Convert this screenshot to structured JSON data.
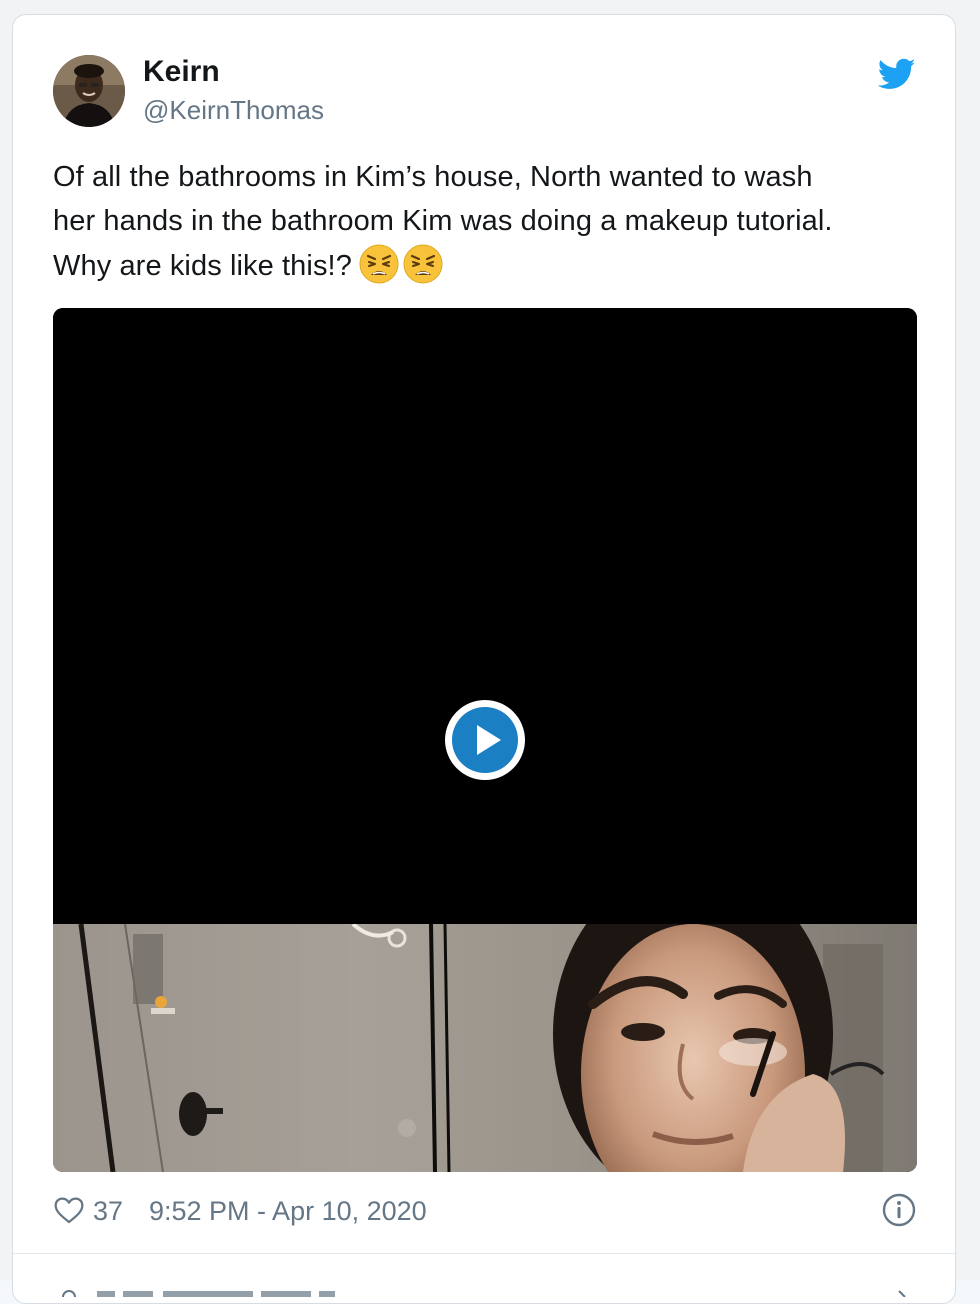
{
  "tweet": {
    "author_name": "Keirn",
    "author_handle": "@KeirnThomas",
    "text_line1": "Of all the bathrooms in Kim’s house, North wanted to wash",
    "text_line2": "her hands in the bathroom Kim was doing a makeup tutorial.",
    "text_line3": "Why are kids like this!?",
    "emojis": [
      "weary-face-icon",
      "weary-face-icon"
    ],
    "like_count": "37",
    "timestamp": "9:52 PM - Apr 10, 2020"
  },
  "icons": {
    "brand": "twitter-bird-icon",
    "like": "heart-icon",
    "info": "info-icon",
    "play": "play-icon"
  },
  "colors": {
    "twitter_blue": "#1da1f2",
    "play_blue": "#1b7fc4",
    "muted_text": "#657786",
    "text": "#14171a"
  }
}
